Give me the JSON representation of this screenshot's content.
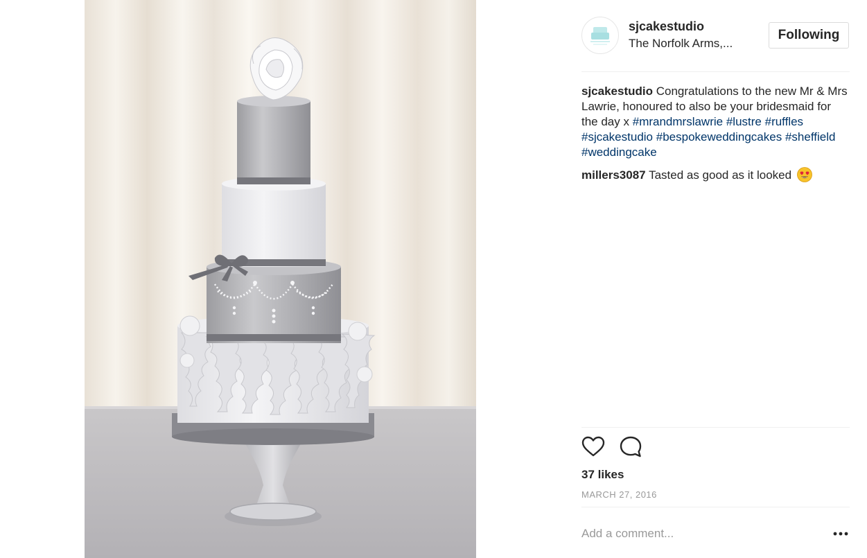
{
  "post": {
    "author": "sjcakestudio",
    "location": "The Norfolk Arms,...",
    "follow_label": "Following",
    "photo_alt": "sjcakestudio post image"
  },
  "comments": [
    {
      "user": "sjcakestudio",
      "text_before_tags": "Congratulations to the new Mr & Mrs Lawrie, honoured to also be your bridesmaid for the day x",
      "hashtags": [
        "#mrandmrslawrie",
        "#lustre",
        "#ruffles",
        "#sjcakestudio",
        "#bespokeweddingcakes",
        "#sheffield",
        "#weddingcake"
      ]
    },
    {
      "user": "millers3087",
      "text": "Tasted as good as it looked",
      "emoji_icon": "heart-eyes-emoji-icon"
    }
  ],
  "actions": {
    "like_icon": "heart-outline-icon",
    "comment_icon": "speech-bubble-icon"
  },
  "likes": "37 likes",
  "date": "MARCH 27, 2016",
  "add_comment": {
    "placeholder": "Add a comment...",
    "more_icon": "more-options-icon"
  },
  "colors": {
    "text": "#262626",
    "hashtag": "#003569",
    "muted": "#999999",
    "border": "#efefef",
    "cake_silver": "#a9a9ab",
    "ribbon": "#7d7d82"
  }
}
